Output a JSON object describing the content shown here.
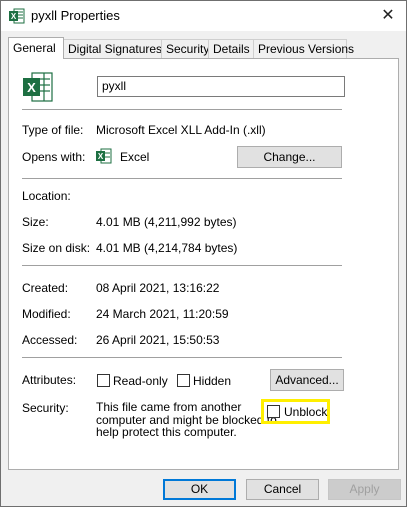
{
  "window": {
    "title": "pyxll Properties",
    "close_glyph": "✕"
  },
  "tabs": [
    {
      "label": "General",
      "active": true
    },
    {
      "label": "Digital Signatures",
      "active": false
    },
    {
      "label": "Security",
      "active": false
    },
    {
      "label": "Details",
      "active": false
    },
    {
      "label": "Previous Versions",
      "active": false
    }
  ],
  "general": {
    "file_name": "pyxll",
    "type_of_file": {
      "label": "Type of file:",
      "value": "Microsoft Excel XLL Add-In (.xll)"
    },
    "opens_with": {
      "label": "Opens with:",
      "value": "Excel",
      "button": "Change..."
    },
    "location": {
      "label": "Location:",
      "value": ""
    },
    "size": {
      "label": "Size:",
      "value": "4.01 MB (4,211,992 bytes)"
    },
    "size_on_disk": {
      "label": "Size on disk:",
      "value": "4.01 MB (4,214,784 bytes)"
    },
    "created": {
      "label": "Created:",
      "value": "08 April 2021, 13:16:22"
    },
    "modified": {
      "label": "Modified:",
      "value": "24 March 2021, 11:20:59"
    },
    "accessed": {
      "label": "Accessed:",
      "value": "26 April 2021, 15:50:53"
    },
    "attributes": {
      "label": "Attributes:",
      "readonly": "Read-only",
      "hidden": "Hidden",
      "advanced_button": "Advanced..."
    },
    "security": {
      "label": "Security:",
      "line1": "This file came from another",
      "line2": "computer and might be blocked to",
      "line3": "help protect this computer.",
      "unblock": "Unblock"
    }
  },
  "footer": {
    "ok": "OK",
    "cancel": "Cancel",
    "apply": "Apply"
  },
  "colors": {
    "highlight": "#ffef00",
    "excel_green": "#1d6f42",
    "default_button_border": "#0078d7"
  }
}
